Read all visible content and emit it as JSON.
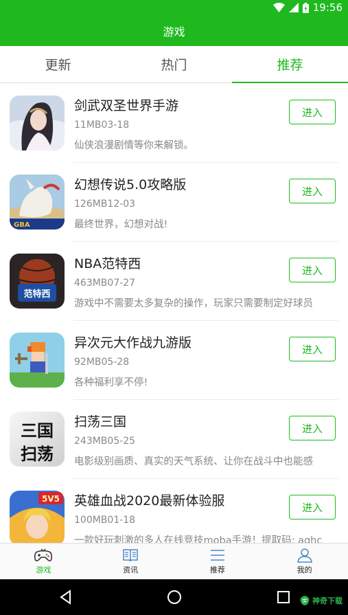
{
  "status_bar": {
    "time": "19:56"
  },
  "app_title": "游戏",
  "tabs": [
    {
      "label": "更新",
      "active": false
    },
    {
      "label": "热门",
      "active": false
    },
    {
      "label": "推荐",
      "active": true
    }
  ],
  "games": [
    {
      "name": "剑武双圣世界手游",
      "meta": "11MB03-18",
      "desc": "仙侠浪漫剧情等你来解锁。",
      "button": "进入",
      "icon": "fairy-heroine-icon"
    },
    {
      "name": "幻想传说5.0攻略版",
      "meta": "126MB12-03",
      "desc": "最终世界，幻想对战!",
      "button": "进入",
      "icon": "white-beast-gba-icon",
      "icon_text": "GBA"
    },
    {
      "name": "NBA范特西",
      "meta": "463MB07-27",
      "desc": "游戏中不需要太多复杂的操作，玩家只需要制定好球员",
      "button": "进入",
      "icon": "nba-fantasy-icon",
      "icon_text": "范特西"
    },
    {
      "name": "异次元大作战九游版",
      "meta": "92MB05-28",
      "desc": "各种福利享不停!",
      "button": "进入",
      "icon": "pixel-warrior-icon"
    },
    {
      "name": "扫荡三国",
      "meta": "243MB05-25",
      "desc": "电影级别画质、真实的天气系统、让你在战斗中也能感",
      "button": "进入",
      "icon": "three-kingdoms-calligraphy-icon",
      "icon_text": "三国扫荡"
    },
    {
      "name": "英雄血战2020最新体验服",
      "meta": "100MB01-18",
      "desc": "一款好玩刺激的多人在线竞技moba手游！提取码: aghc",
      "button": "进入",
      "icon": "moba-5v5-icon",
      "icon_text": "5V5"
    }
  ],
  "bottom_nav": [
    {
      "label": "游戏",
      "icon": "gamepad-icon",
      "active": true
    },
    {
      "label": "资讯",
      "icon": "book-icon",
      "active": false
    },
    {
      "label": "推荐",
      "icon": "list-icon",
      "active": false
    },
    {
      "label": "我的",
      "icon": "person-icon",
      "active": false
    }
  ],
  "watermark": "神奇下载",
  "colors": {
    "accent": "#1fb91f",
    "text_primary": "#222222",
    "text_secondary": "#888888"
  }
}
